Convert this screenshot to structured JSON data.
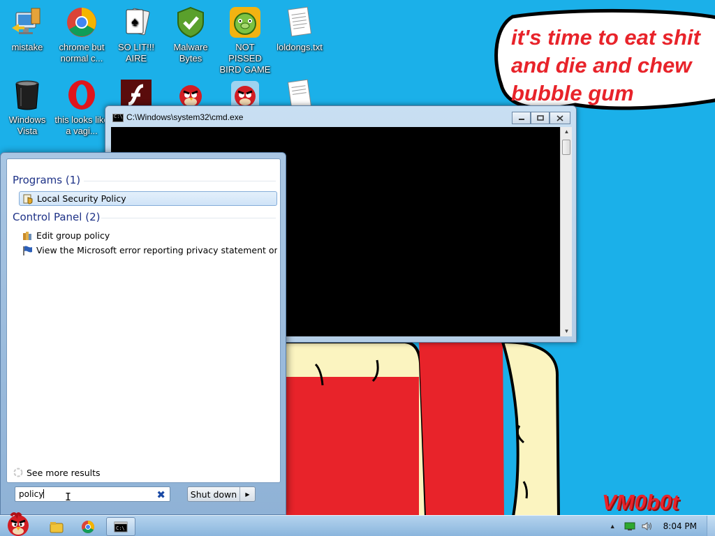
{
  "desktop": {
    "icons": [
      {
        "label": "mistake",
        "icon": "computer-network-icon"
      },
      {
        "label": "chrome but normal c...",
        "icon": "chrome-icon"
      },
      {
        "label": "SO LIT!!! AIRE",
        "icon": "solitaire-icon"
      },
      {
        "label": "Malware Bytes",
        "icon": "shield-check-icon"
      },
      {
        "label": "NOT PISSED BIRD GAME",
        "icon": "green-pig-icon"
      },
      {
        "label": "loldongs.txt",
        "icon": "text-file-icon"
      },
      {
        "label": "Windows Vista",
        "icon": "trash-bin-icon"
      },
      {
        "label": "this looks like a vagi...",
        "icon": "opera-icon"
      },
      {
        "label": "",
        "icon": "flash-icon"
      },
      {
        "label": "",
        "icon": "red-bird-icon"
      },
      {
        "label": "",
        "icon": "red-bird-icon"
      },
      {
        "label": "",
        "icon": "text-file-icon"
      }
    ],
    "wallpaper_text": "it's time to eat shit and die and chew bubble gum",
    "watermark": "VM0b0t",
    "colors": {
      "background": "#1bb0e9",
      "text_red": "#e8232a"
    }
  },
  "cmd_window": {
    "title": "C:\\Windows\\system32\\cmd.exe",
    "minimize_symbol": "▭",
    "maximize_symbol": "▭",
    "close_symbol": "✕"
  },
  "start_menu": {
    "groups": [
      {
        "title": "Programs (1)",
        "items": [
          {
            "label": "Local Security Policy",
            "icon": "security-policy-icon",
            "selected": true
          }
        ]
      },
      {
        "title": "Control Panel (2)",
        "items": [
          {
            "label": "Edit group policy",
            "icon": "group-policy-icon",
            "selected": false
          },
          {
            "label": "View the Microsoft error reporting privacy statement onli...",
            "icon": "flag-icon",
            "selected": false
          }
        ]
      }
    ],
    "see_more": "See more results",
    "search": {
      "value": "policy"
    },
    "shutdown_label": "Shut down"
  },
  "taskbar": {
    "clock": "8:04 PM",
    "show_hidden_symbol": "▲"
  }
}
